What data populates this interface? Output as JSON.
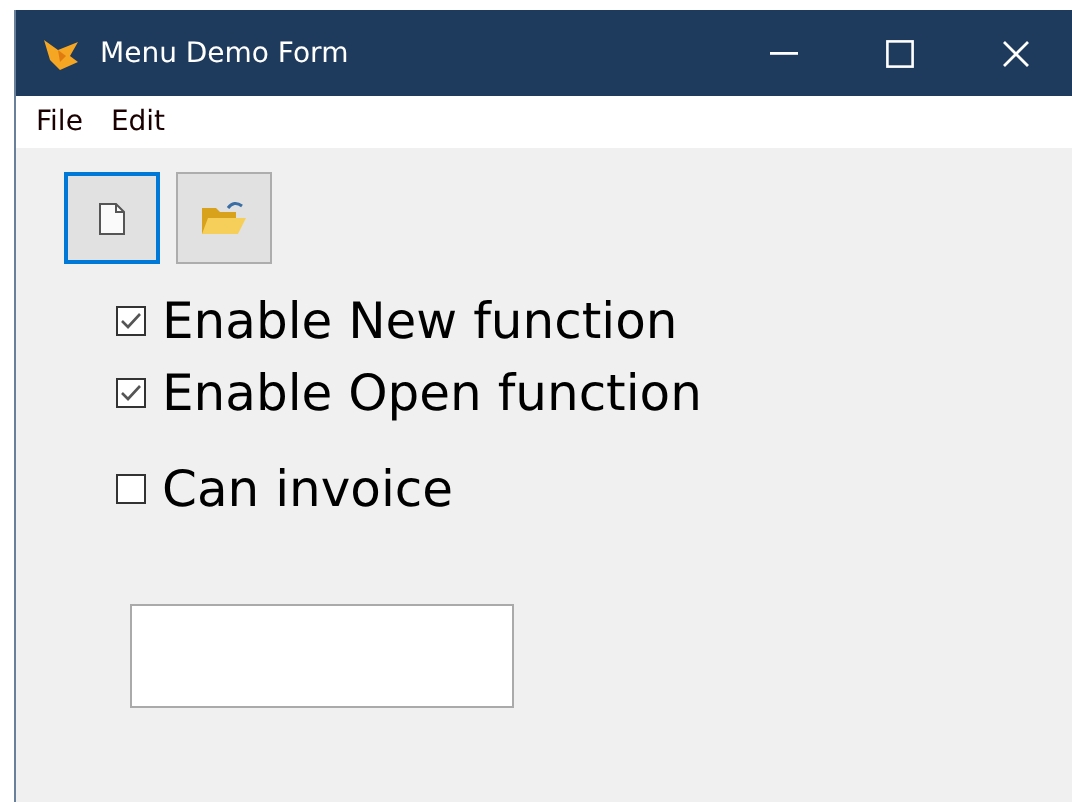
{
  "window": {
    "title": "Menu Demo Form"
  },
  "menu": [
    {
      "label": "File"
    },
    {
      "label": "Edit"
    }
  ],
  "toolbar": [
    {
      "kind": "new",
      "selected": true
    },
    {
      "kind": "open",
      "selected": false
    }
  ],
  "checkboxes": [
    {
      "label": "Enable New function",
      "checked": true
    },
    {
      "label": "Enable Open function",
      "checked": true
    },
    {
      "label": "Can invoice",
      "checked": false
    }
  ]
}
